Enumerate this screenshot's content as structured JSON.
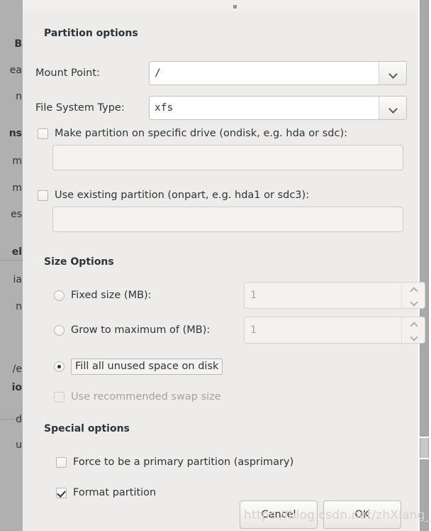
{
  "dialog": {
    "sections": {
      "partition_options": "Partition options",
      "size_options": "Size Options",
      "special_options": "Special options"
    },
    "fields": {
      "mount_point_label": "Mount Point:",
      "mount_point_value": "/",
      "file_system_label": "File System Type:",
      "file_system_value": "xfs"
    },
    "checkboxes": {
      "ondisk_label": "Make partition on specific drive (ondisk, e.g. hda or sdc):",
      "ondisk_checked": false,
      "ondisk_value": "",
      "onpart_label": "Use existing partition (onpart, e.g. hda1 or sdc3):",
      "onpart_checked": false,
      "onpart_value": "",
      "swap_label": "Use recommended swap size",
      "swap_checked": false,
      "asprimary_label": "Force to be a primary partition (asprimary)",
      "asprimary_checked": false,
      "format_label": "Format partition",
      "format_checked": true
    },
    "size": {
      "fixed_label": "Fixed size (MB):",
      "fixed_value": "1",
      "fixed_selected": false,
      "grow_label": "Grow to maximum of (MB):",
      "grow_value": "1",
      "grow_selected": false,
      "fill_label": "Fill all unused space on disk",
      "fill_selected": true
    },
    "buttons": {
      "cancel": "Cancel",
      "ok": "OK"
    }
  },
  "watermark": {
    "text": "https://blog.csdn.net/zhXiang_Guo"
  },
  "background_window": {
    "left_fragments": [
      "B",
      "ea",
      "n",
      "ns",
      "m",
      "m",
      "es",
      "el",
      "ia",
      "n",
      "e/",
      "io",
      "d",
      "u"
    ]
  },
  "colors": {
    "dialog_bg": "#edeceb",
    "text": "#2e3436",
    "disabled_text": "#a7a29d",
    "border": "#c3c0bd",
    "underlying_window": "#b0b0b0",
    "watermark": "#d3d2d1"
  }
}
